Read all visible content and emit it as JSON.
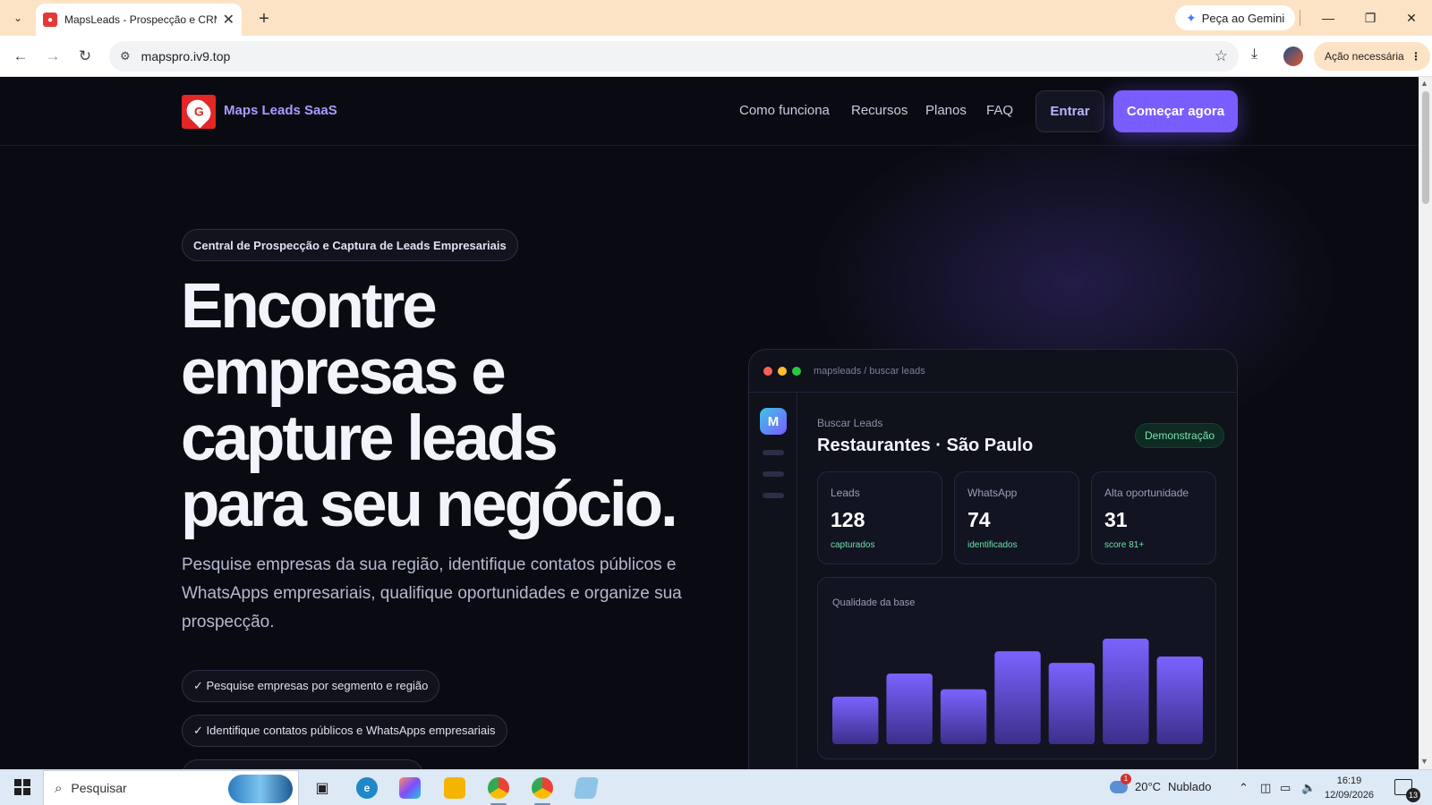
{
  "browser": {
    "tab_title": "MapsLeads - Prospecção e CRM",
    "new_tab": "+",
    "close": "✕",
    "gemini_label": "Peça ao Gemini",
    "url": "mapspro.iv9.top",
    "action_label": "Ação necessária",
    "icons": {
      "back": "←",
      "forward": "→",
      "reload": "↻",
      "bookmark": "☆",
      "download": "⤓",
      "minimize": "—",
      "restore": "❐",
      "close": "✕",
      "tab_list": "⌄",
      "more": "⋮",
      "site_info": "⚙"
    }
  },
  "site": {
    "brand": "Maps Leads SaaS",
    "logo_letter": "G",
    "nav": [
      "Como funciona",
      "Recursos",
      "Planos",
      "FAQ"
    ],
    "login_label": "Entrar",
    "cta_label": "Começar agora"
  },
  "hero": {
    "badge": "Central de Prospecção e Captura de Leads Empresariais",
    "title_lines": [
      "Encontre",
      "empresas e",
      "capture leads",
      "para seu negócio."
    ],
    "description": "Pesquise empresas da sua região, identifique contatos públicos e WhatsApps empresariais, qualifique oportunidades e organize sua prospecção.",
    "features": [
      "✓ Pesquise empresas por segmento e região",
      "✓ Identifique contatos públicos e WhatsApps empresariais"
    ]
  },
  "dashboard": {
    "path": "mapsleads / buscar leads",
    "avatar": "M",
    "label": "Buscar Leads",
    "heading": "Restaurantes · São Paulo",
    "badge": "Demonstração",
    "stats": [
      {
        "label": "Leads",
        "value": "128",
        "sub": "capturados"
      },
      {
        "label": "WhatsApp",
        "value": "74",
        "sub": "identificados"
      },
      {
        "label": "Alta oportunidade",
        "value": "31",
        "sub": "score 81+"
      }
    ],
    "chart_title": "Qualidade da base",
    "colors": {
      "bar_top": "#7a63ff",
      "bar_bottom": "#3b2f8a"
    }
  },
  "chart_data": {
    "type": "bar",
    "title": "Qualidade da base",
    "categories": [],
    "values": [
      45,
      67,
      52,
      88,
      77,
      100,
      83
    ],
    "ylim": [
      0,
      100
    ],
    "grid": false
  },
  "taskbar": {
    "search_placeholder": "Pesquisar",
    "weather_temp": "20°C",
    "weather_desc": "Nublado",
    "weather_badge": "1",
    "time": "16:19",
    "date": "12/09/2026",
    "notifications": "13",
    "icons": [
      "task-view-icon",
      "edge-icon",
      "copilot-icon",
      "file-explorer-icon",
      "chrome-icon",
      "chrome-profile-icon",
      "notepad-icon"
    ]
  }
}
